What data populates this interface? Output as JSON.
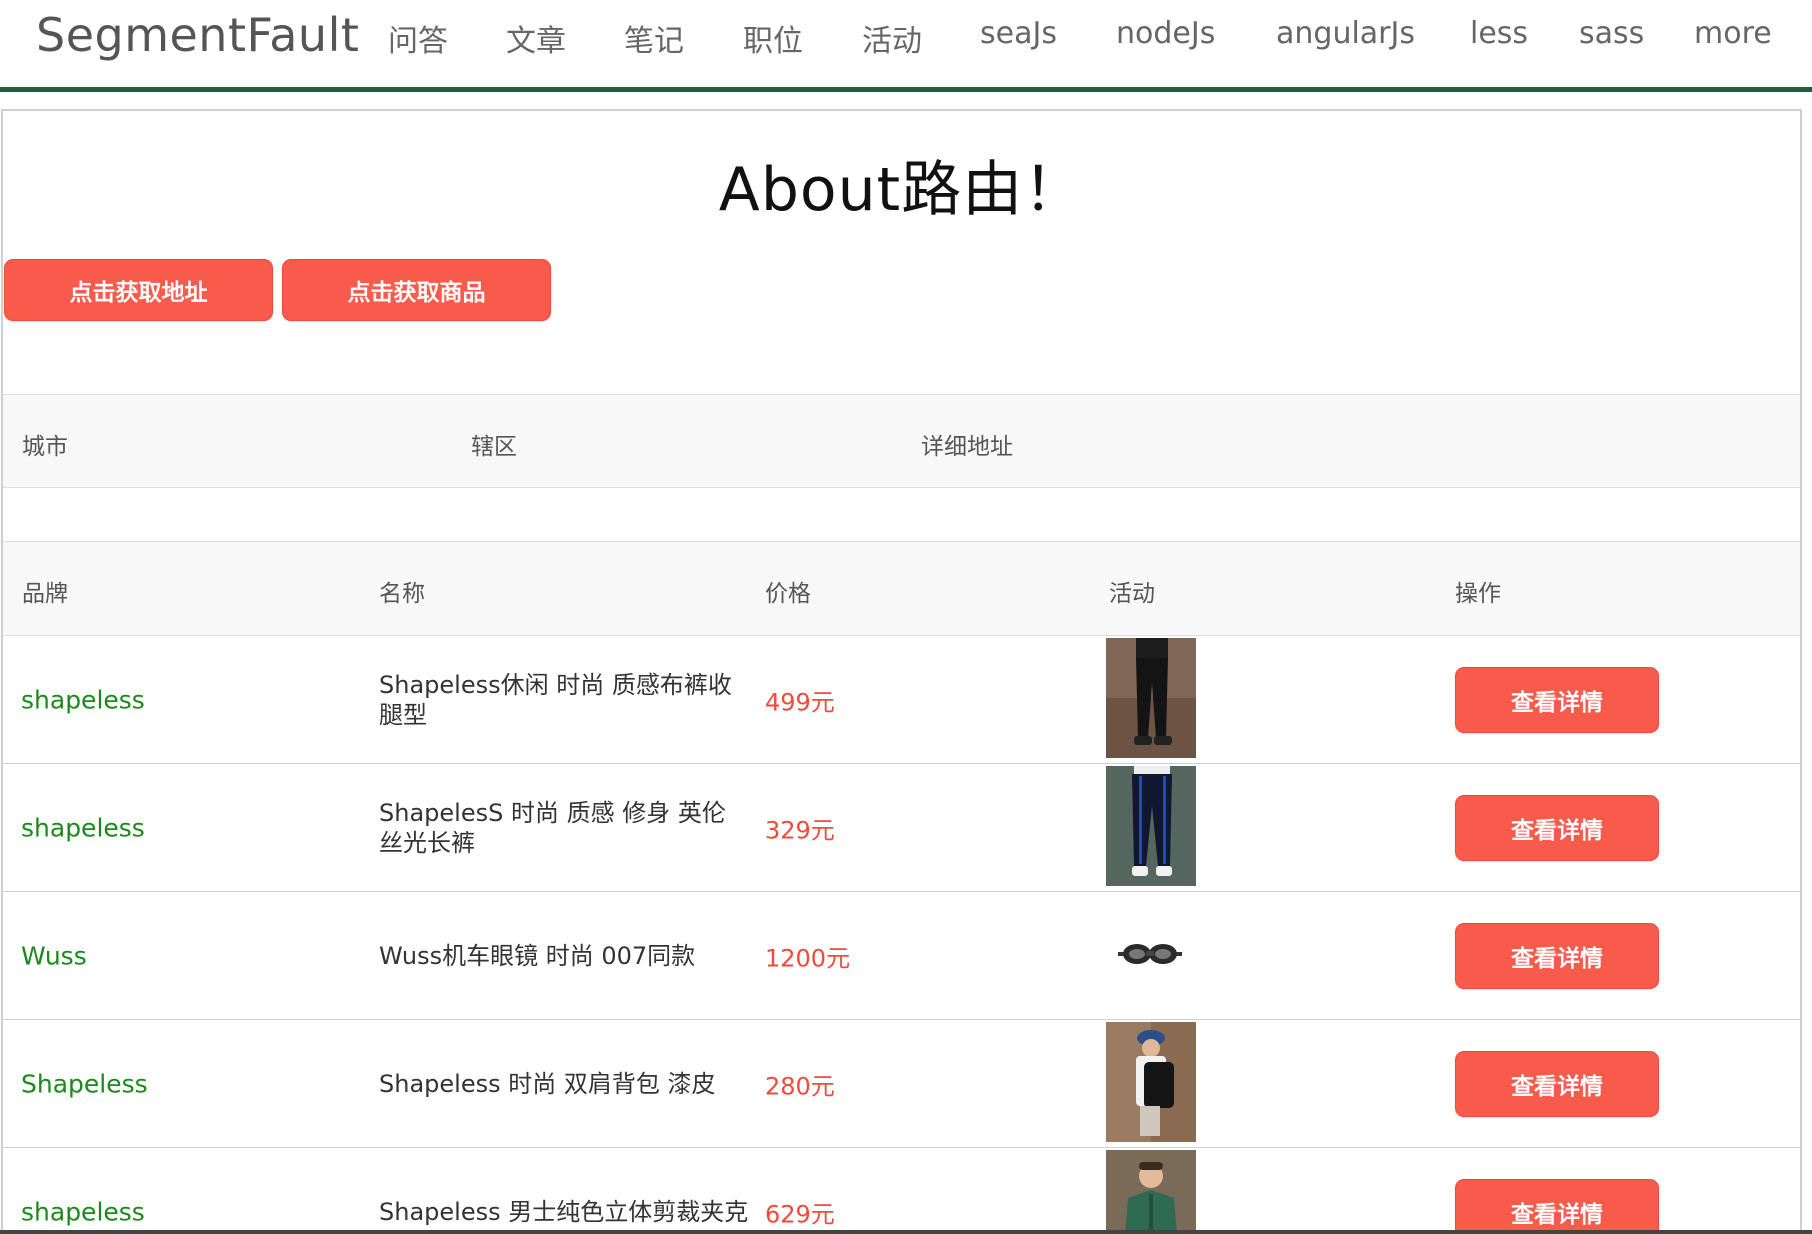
{
  "nav": {
    "logo": "SegmentFault",
    "items": [
      "问答",
      "文章",
      "笔记",
      "职位",
      "活动",
      "seaJs",
      "nodeJs",
      "angularJs",
      "less",
      "sass",
      "more"
    ]
  },
  "page": {
    "title": "About路由！",
    "btn_address": "点击获取地址",
    "btn_goods": "点击获取商品"
  },
  "address_table": {
    "headers": [
      "城市",
      "辖区",
      "详细地址"
    ]
  },
  "goods_table": {
    "headers": [
      "品牌",
      "名称",
      "价格",
      "活动",
      "操作"
    ],
    "rows": [
      {
        "brand": "shapeless",
        "name": "Shapeless休闲 时尚 质感布裤收腿型",
        "price": "499元",
        "image": "black-pants",
        "action": "查看详情"
      },
      {
        "brand": "shapeless",
        "name": "ShapelesS 时尚 质感 修身 英伦丝光长裤",
        "price": "329元",
        "image": "striped-pants",
        "action": "查看详情"
      },
      {
        "brand": "Wuss",
        "name": "Wuss机车眼镜 时尚 007同款",
        "price": "1200元",
        "image": "moto-goggles",
        "action": "查看详情"
      },
      {
        "brand": "Shapeless",
        "name": "Shapeless 时尚 双肩背包 漆皮",
        "price": "280元",
        "image": "backpack-model",
        "action": "查看详情"
      },
      {
        "brand": "shapeless",
        "name": "Shapeless 男士纯色立体剪裁夹克",
        "price": "629元",
        "image": "green-jacket-model",
        "action": "查看详情"
      }
    ]
  },
  "colors": {
    "accent_red": "#f85a4c",
    "brand_green": "#1b8a1b",
    "nav_border": "#1e5e3a"
  }
}
